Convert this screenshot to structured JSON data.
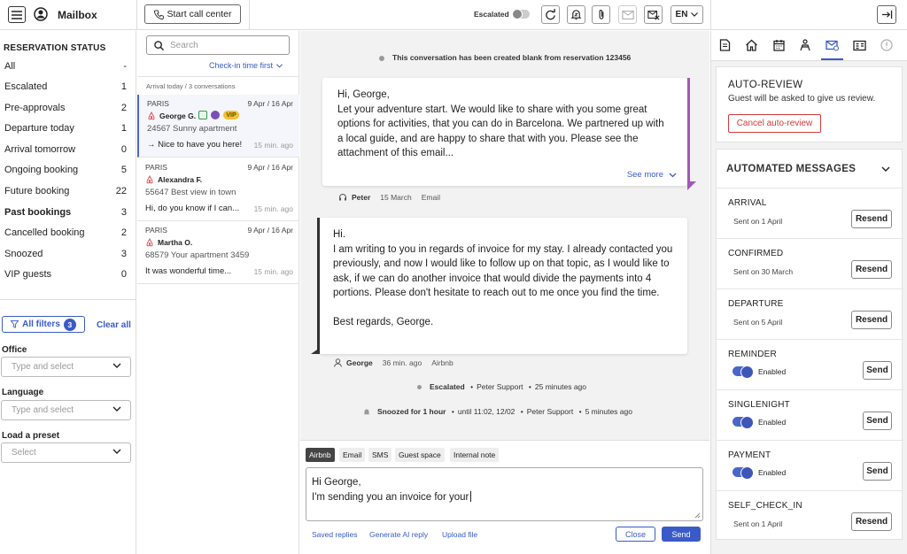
{
  "app": {
    "title": "Mailbox"
  },
  "topbar": {
    "call_center_label": "Start call center",
    "escalated_label": "Escalated",
    "language": "EN"
  },
  "sidebar": {
    "heading": "RESERVATION STATUS",
    "statuses": [
      {
        "label": "All",
        "count": "-"
      },
      {
        "label": "Escalated",
        "count": "1"
      },
      {
        "label": "Pre-approvals",
        "count": "2"
      },
      {
        "label": "Departure today",
        "count": "1"
      },
      {
        "label": "Arrival tomorrow",
        "count": "0"
      },
      {
        "label": "Ongoing booking",
        "count": "5"
      },
      {
        "label": "Future booking",
        "count": "22"
      },
      {
        "label": "Past bookings",
        "count": "3"
      },
      {
        "label": "Cancelled booking",
        "count": "2"
      },
      {
        "label": "Snoozed",
        "count": "3"
      },
      {
        "label": "VIP guests",
        "count": "0"
      }
    ],
    "filters": {
      "button_label": "All filters",
      "count": "3",
      "clear_label": "Clear all",
      "office_label": "Office",
      "office_placeholder": "Type and select",
      "language_label": "Language",
      "language_placeholder": "Type and select",
      "preset_label": "Load a preset",
      "preset_placeholder": "Select"
    }
  },
  "conversations": {
    "search_placeholder": "Search",
    "sort_label": "Check-in time first",
    "group_label": "Arrival today / 3 conversations",
    "items": [
      {
        "city": "PARIS",
        "dates": "9 Apr / 16 Apr",
        "guest": "George G.",
        "badge": "VIP",
        "apartment": "24567 Sunny apartment",
        "preview": "→ Nice to have you here!",
        "ago": "15 min. ago"
      },
      {
        "city": "PARIS",
        "dates": "9 Apr / 16 Apr",
        "guest": "Alexandra F.",
        "apartment": "55647 Best view in town",
        "preview": "Hi, do you know if I can...",
        "ago": "15 min. ago"
      },
      {
        "city": "PARIS",
        "dates": "9 Apr / 16 Apr",
        "guest": "Martha O.",
        "apartment": "68579 Your apartment 3459",
        "preview": "It was wonderful time...",
        "ago": "15 min. ago"
      }
    ]
  },
  "thread": {
    "created_note": "This conversation has been created blank from reservation 123456",
    "message1": {
      "greeting": "Hi, George,",
      "body": "Let your adventure start. We would like to share with you some great options for activities, that you can do in Barcelona. We partnered up with a local guide, and are happy to share that with you. Please see the attachment of this email...",
      "see_more": "See more",
      "author": "Peter",
      "date": "15 March",
      "channel": "Email"
    },
    "message2": {
      "greeting": "Hi.",
      "body": "I am writing to you in regards of invoice for my stay. I already contacted you previously, and now I would like to follow up on that topic, as I would like to ask, if we can do another invoice that would divide the payments into 4 portions. Please don't hesitate to reach out to me once you find the time.",
      "signoff": "Best regards, George.",
      "author": "George",
      "time": "36 min. ago",
      "channel": "Airbnb"
    },
    "event1": {
      "title": "Escalated",
      "by": "Peter Support",
      "time": "25 minutes ago"
    },
    "event2": {
      "title": "Snoozed for 1 hour",
      "until": "until 11:02, 12/02",
      "by": "Peter Support",
      "time": "5 minutes ago"
    }
  },
  "composer": {
    "tabs": [
      "Airbnb",
      "Email",
      "SMS",
      "Guest space",
      "Internal note"
    ],
    "active_tab": "Airbnb",
    "text_line1": "Hi George,",
    "text_line2": "I'm sending you an invoice for your",
    "saved_replies": "Saved replies",
    "generate_ai": "Generate AI reply",
    "upload_file": "Upload file",
    "close_label": "Close",
    "send_label": "Send"
  },
  "right_panel": {
    "auto_review": {
      "title": "AUTO-REVIEW",
      "description": "Guest will be asked to give us review.",
      "cancel_label": "Cancel auto-review"
    },
    "automated_messages": {
      "title": "AUTOMATED MESSAGES",
      "items": [
        {
          "name": "ARRIVAL",
          "status": "Sent on 1 April",
          "action": "Resend"
        },
        {
          "name": "CONFIRMED",
          "status": "Sent on 30 March",
          "action": "Resend"
        },
        {
          "name": "DEPARTURE",
          "status": "Sent on 5 April",
          "action": "Resend"
        },
        {
          "name": "REMINDER",
          "status": "Enabled",
          "action": "Send"
        },
        {
          "name": "SINGLENIGHT",
          "status": "Enabled",
          "action": "Send"
        },
        {
          "name": "PAYMENT",
          "status": "Enabled",
          "action": "Send"
        },
        {
          "name": "SELF_CHECK_IN",
          "status": "Sent on 1 April",
          "action": "Resend"
        }
      ]
    }
  },
  "colors": {
    "accent": "#3a5bc7",
    "danger": "#d33a3a",
    "vip": "#f1c232",
    "airbnb": "#e0565b"
  }
}
